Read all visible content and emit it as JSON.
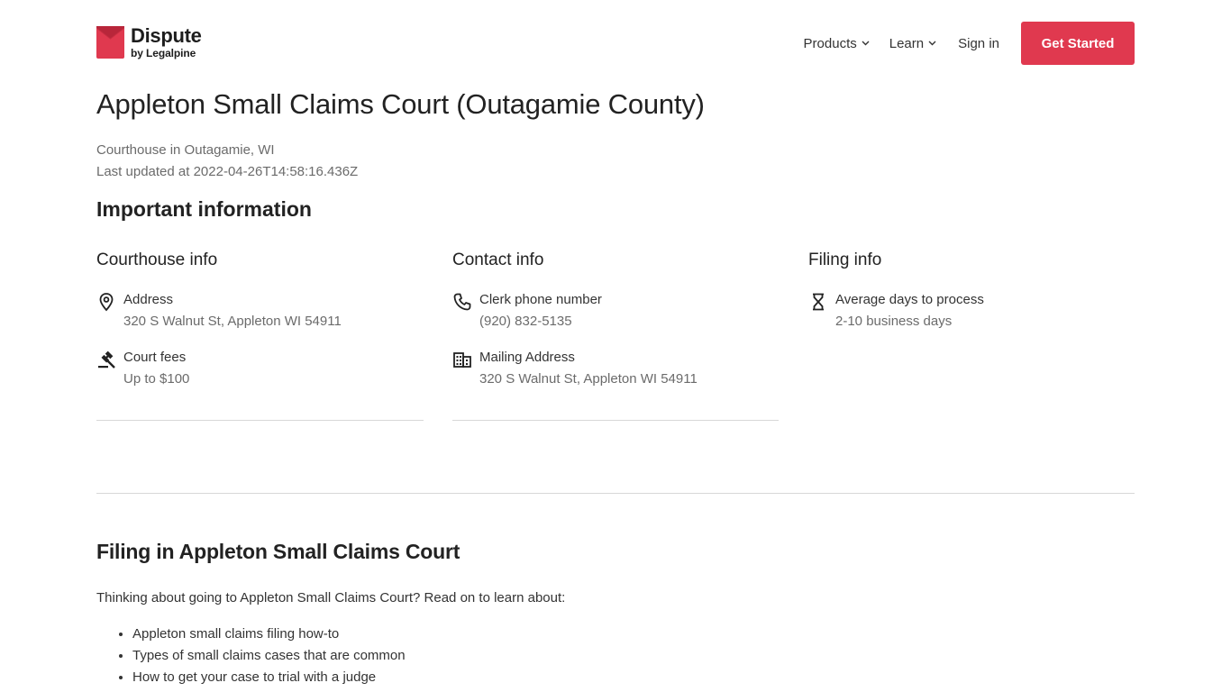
{
  "brand": {
    "name": "Dispute",
    "byline": "by Legalpine",
    "accent": "#e0394f",
    "icon": "envelope-logo-icon"
  },
  "nav": {
    "items": [
      {
        "label": "Products",
        "icon": "chevron-down-icon"
      },
      {
        "label": "Learn",
        "icon": "chevron-down-icon"
      }
    ],
    "signin": "Sign in",
    "cta": "Get Started"
  },
  "page": {
    "title": "Appleton Small Claims Court (Outagamie County)",
    "subtitle": "Courthouse in Outagamie, WI",
    "updated": "Last updated at 2022-04-26T14:58:16.436Z",
    "section_title": "Important information"
  },
  "columns": [
    {
      "heading": "Courthouse info",
      "rows": [
        {
          "icon": "location-pin-icon",
          "label": "Address",
          "value": "320 S Walnut St, Appleton WI 54911"
        },
        {
          "icon": "gavel-icon",
          "label": "Court fees",
          "value": "Up to $100"
        }
      ]
    },
    {
      "heading": "Contact info",
      "rows": [
        {
          "icon": "phone-icon",
          "label": "Clerk phone number",
          "value": "(920) 832-5135"
        },
        {
          "icon": "building-icon",
          "label": "Mailing Address",
          "value": "320 S Walnut St, Appleton WI 54911"
        }
      ]
    },
    {
      "heading": "Filing info",
      "rows": [
        {
          "icon": "hourglass-icon",
          "label": "Average days to process",
          "value": "2-10 business days"
        }
      ]
    }
  ],
  "filing": {
    "title": "Filing in Appleton Small Claims Court",
    "intro": "Thinking about going to Appleton Small Claims Court? Read on to learn about:",
    "topics": [
      "Appleton small claims filing how-to",
      "Types of small claims cases that are common",
      "How to get your case to trial with a judge"
    ]
  }
}
